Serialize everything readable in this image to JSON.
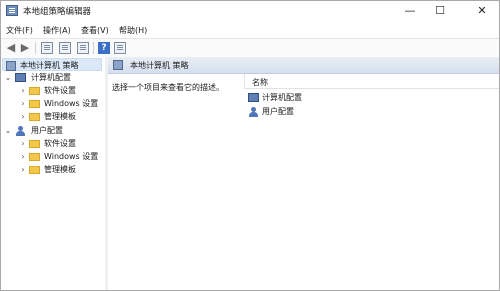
{
  "window": {
    "title": "本地组策略编辑器",
    "controls": {
      "minimize": "—",
      "maximize": "☐",
      "close": "✕"
    }
  },
  "menu": [
    "文件(F)",
    "操作(A)",
    "查看(V)",
    "帮助(H)"
  ],
  "tree": {
    "root": "本地计算机 策略",
    "computer": {
      "label": "计算机配置",
      "children": [
        "软件设置",
        "Windows 设置",
        "管理模板"
      ]
    },
    "user": {
      "label": "用户配置",
      "children": [
        "软件设置",
        "Windows 设置",
        "管理模板"
      ]
    }
  },
  "right": {
    "header": "本地计算机 策略",
    "description": "选择一个项目来查看它的描述。",
    "column": "名称",
    "items": [
      "计算机配置",
      "用户配置"
    ]
  }
}
